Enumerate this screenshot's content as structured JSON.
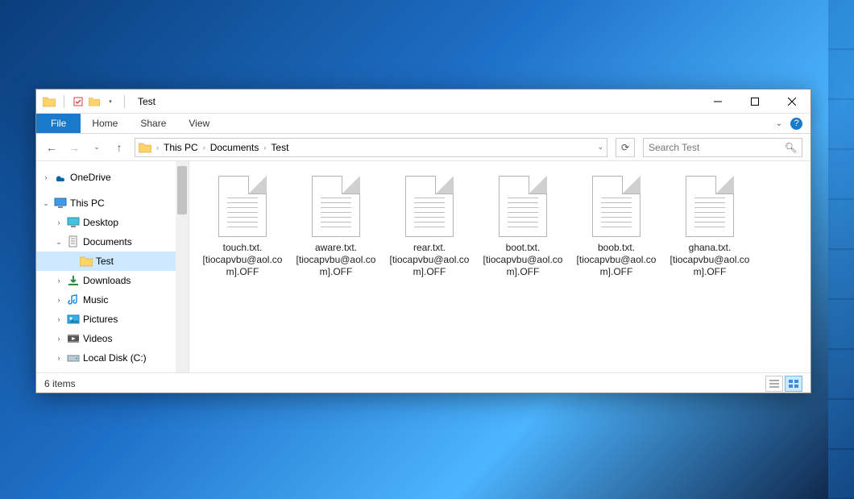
{
  "titlebar": {
    "title": "Test"
  },
  "ribbon": {
    "file": "File",
    "home": "Home",
    "share": "Share",
    "view": "View"
  },
  "breadcrumbs": {
    "b0": "This PC",
    "b1": "Documents",
    "b2": "Test"
  },
  "search": {
    "placeholder": "Search Test"
  },
  "sidebar": {
    "onedrive": "OneDrive",
    "thispc": "This PC",
    "desktop": "Desktop",
    "documents": "Documents",
    "test": "Test",
    "downloads": "Downloads",
    "music": "Music",
    "pictures": "Pictures",
    "videos": "Videos",
    "localdisk": "Local Disk (C:)"
  },
  "files": [
    {
      "name": "touch.txt.[tiocapvbu@aol.com].OFF"
    },
    {
      "name": "aware.txt.[tiocapvbu@aol.com].OFF"
    },
    {
      "name": "rear.txt.[tiocapvbu@aol.com].OFF"
    },
    {
      "name": "boot.txt.[tiocapvbu@aol.com].OFF"
    },
    {
      "name": "boob.txt.[tiocapvbu@aol.com].OFF"
    },
    {
      "name": "ghana.txt.[tiocapvbu@aol.com].OFF"
    }
  ],
  "status": {
    "count": "6 items"
  }
}
